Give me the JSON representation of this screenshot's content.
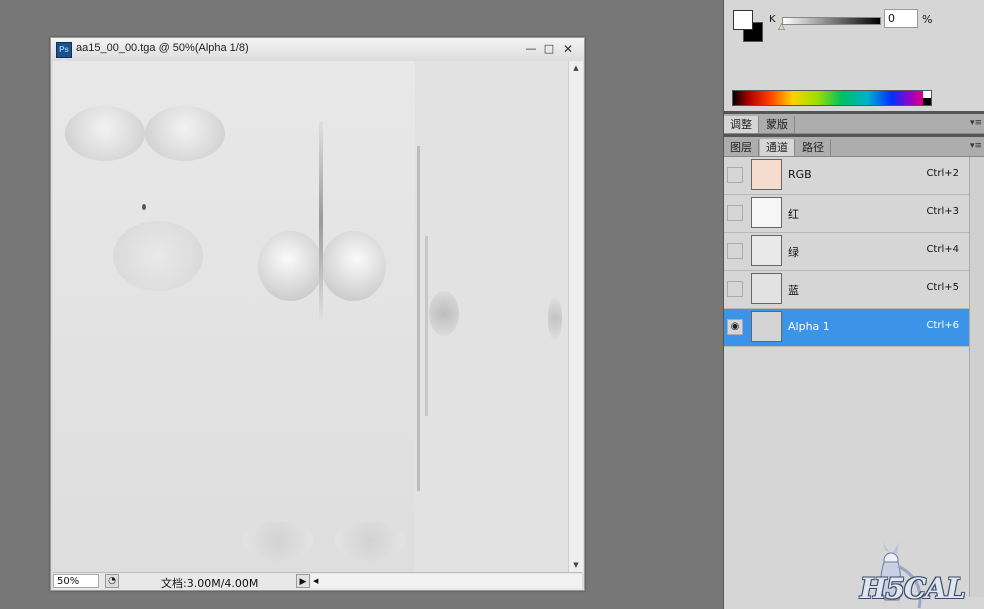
{
  "document": {
    "title": "aa15_00_00.tga @ 50%(Alpha 1/8)",
    "app_icon": "Ps",
    "zoom": "50%",
    "doc_size": "文档:3.00M/4.00M"
  },
  "color_panel": {
    "channel_label": "K",
    "value": "0",
    "unit": "%",
    "slider_fraction": 0
  },
  "adjust_tabs": [
    {
      "label": "调整",
      "active": true
    },
    {
      "label": "蒙版",
      "active": false
    }
  ],
  "layer_tabs": [
    {
      "label": "图层",
      "active": false
    },
    {
      "label": "通道",
      "active": true
    },
    {
      "label": "路径",
      "active": false
    }
  ],
  "channels": [
    {
      "name": "RGB",
      "shortcut": "Ctrl+2",
      "thumb_color": "#f6dccd",
      "visible": false,
      "selected": false
    },
    {
      "name": "红",
      "shortcut": "Ctrl+3",
      "thumb_color": "#f6f6f6",
      "visible": false,
      "selected": false
    },
    {
      "name": "绿",
      "shortcut": "Ctrl+4",
      "thumb_color": "#e9e9e9",
      "visible": false,
      "selected": false
    },
    {
      "name": "蓝",
      "shortcut": "Ctrl+5",
      "thumb_color": "#e2e2e2",
      "visible": false,
      "selected": false
    },
    {
      "name": "Alpha 1",
      "shortcut": "Ctrl+6",
      "thumb_color": "#d4d4d4",
      "visible": true,
      "selected": true
    }
  ],
  "watermark": {
    "text": "H5CAL"
  },
  "colors": {
    "selection": "#3c94e8",
    "workspace": "#777777",
    "panel": "#d6d6d6"
  }
}
